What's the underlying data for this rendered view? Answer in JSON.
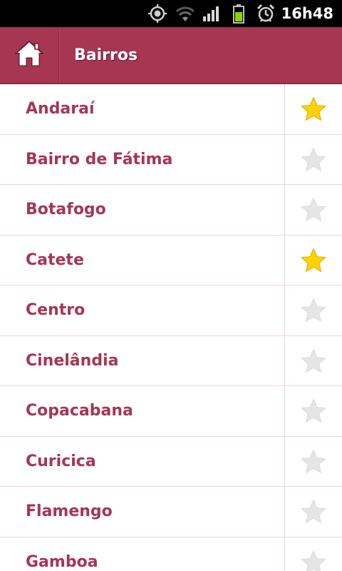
{
  "status_bar": {
    "time": "16h48",
    "icons": [
      "gps-icon",
      "wifi-icon",
      "signal-icon",
      "battery-icon",
      "alarm-icon"
    ],
    "battery_color": "#8fd400"
  },
  "app_bar": {
    "title": "Bairros",
    "home_icon": "home-icon",
    "color": "#a63652"
  },
  "list": {
    "items": [
      {
        "name": "Andaraí",
        "favorite": true
      },
      {
        "name": "Bairro de Fátima",
        "favorite": false
      },
      {
        "name": "Botafogo",
        "favorite": false
      },
      {
        "name": "Catete",
        "favorite": true
      },
      {
        "name": "Centro",
        "favorite": false
      },
      {
        "name": "Cinelândia",
        "favorite": false
      },
      {
        "name": "Copacabana",
        "favorite": false
      },
      {
        "name": "Curicica",
        "favorite": false
      },
      {
        "name": "Flamengo",
        "favorite": false
      },
      {
        "name": "Gamboa",
        "favorite": false
      }
    ],
    "text_color": "#a63652",
    "favorite_color": "#ffd200",
    "unfavorite_color": "#e5e5e5"
  }
}
